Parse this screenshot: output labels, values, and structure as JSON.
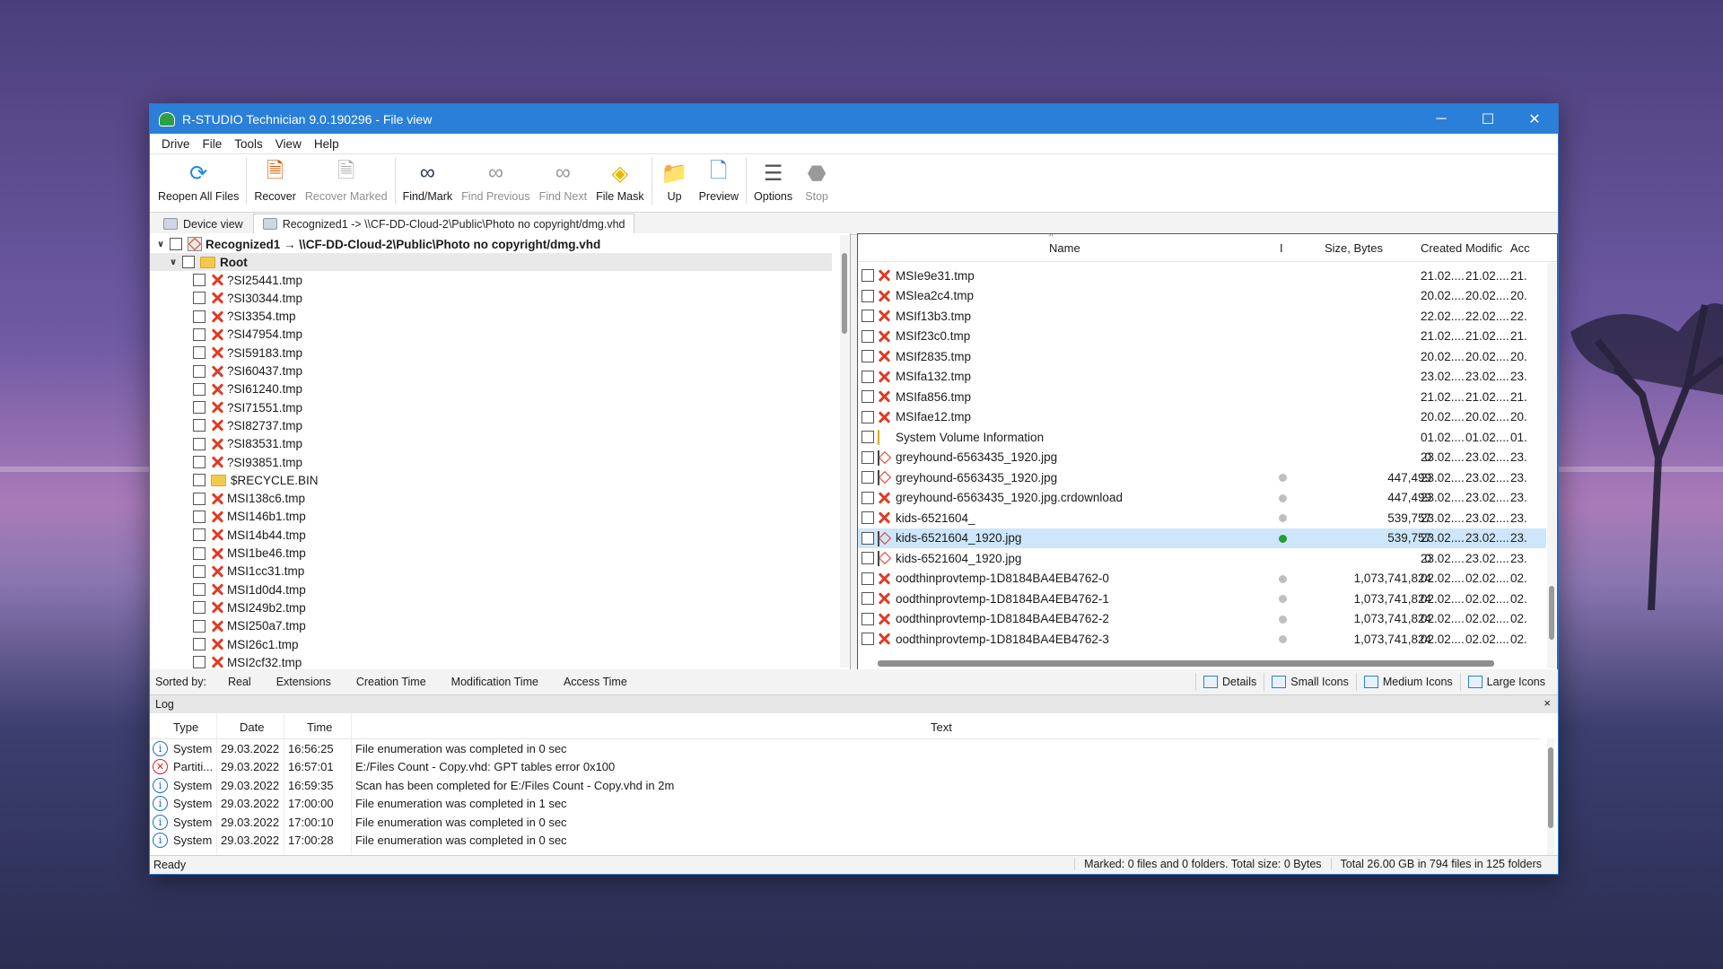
{
  "window": {
    "title": "R-STUDIO Technician 9.0.190296 - File view"
  },
  "menu": [
    "Drive",
    "File",
    "Tools",
    "View",
    "Help"
  ],
  "toolbar": {
    "buttons": [
      {
        "label": "Reopen All Files",
        "icon": "refresh-icon",
        "disabled": false
      },
      {
        "label": "Recover",
        "icon": "recover-icon",
        "disabled": false
      },
      {
        "label": "Recover Marked",
        "icon": "recover-marked-icon",
        "disabled": true
      },
      {
        "label": "Find/Mark",
        "icon": "binoculars-icon",
        "disabled": false
      },
      {
        "label": "Find Previous",
        "icon": "binoculars-prev-icon",
        "disabled": true
      },
      {
        "label": "Find Next",
        "icon": "binoculars-next-icon",
        "disabled": true
      },
      {
        "label": "File Mask",
        "icon": "file-mask-icon",
        "disabled": false
      },
      {
        "label": "Up",
        "icon": "folder-up-icon",
        "disabled": false
      },
      {
        "label": "Preview",
        "icon": "preview-icon",
        "disabled": false
      },
      {
        "label": "Options",
        "icon": "options-icon",
        "disabled": false
      },
      {
        "label": "Stop",
        "icon": "stop-icon",
        "disabled": true
      }
    ]
  },
  "tabs": [
    {
      "label": "Device view"
    },
    {
      "label": "Recognized1 -> \\\\CF-DD-Cloud-2\\Public\\Photo no copyright/dmg.vhd"
    }
  ],
  "tree": {
    "top": "Recognized1 → \\\\CF-DD-Cloud-2\\Public\\Photo no copyright/dmg.vhd",
    "root": "Root",
    "items": [
      {
        "name": "?SI25441.tmp",
        "type": "deleted"
      },
      {
        "name": "?SI30344.tmp",
        "type": "deleted"
      },
      {
        "name": "?SI3354.tmp",
        "type": "deleted"
      },
      {
        "name": "?SI47954.tmp",
        "type": "deleted"
      },
      {
        "name": "?SI59183.tmp",
        "type": "deleted"
      },
      {
        "name": "?SI60437.tmp",
        "type": "deleted"
      },
      {
        "name": "?SI61240.tmp",
        "type": "deleted"
      },
      {
        "name": "?SI71551.tmp",
        "type": "deleted"
      },
      {
        "name": "?SI82737.tmp",
        "type": "deleted"
      },
      {
        "name": "?SI83531.tmp",
        "type": "deleted"
      },
      {
        "name": "?SI93851.tmp",
        "type": "deleted"
      },
      {
        "name": "$RECYCLE.BIN",
        "type": "folder"
      },
      {
        "name": "MSI138c6.tmp",
        "type": "deleted"
      },
      {
        "name": "MSI146b1.tmp",
        "type": "deleted"
      },
      {
        "name": "MSI14b44.tmp",
        "type": "deleted"
      },
      {
        "name": "MSI1be46.tmp",
        "type": "deleted"
      },
      {
        "name": "MSI1cc31.tmp",
        "type": "deleted"
      },
      {
        "name": "MSI1d0d4.tmp",
        "type": "deleted"
      },
      {
        "name": "MSI249b2.tmp",
        "type": "deleted"
      },
      {
        "name": "MSI250a7.tmp",
        "type": "deleted"
      },
      {
        "name": "MSI26c1.tmp",
        "type": "deleted"
      },
      {
        "name": "MSI2cf32.tmp",
        "type": "deleted"
      }
    ]
  },
  "filelist": {
    "columns": {
      "name": "Name",
      "i": "I",
      "size": "Size, Bytes",
      "created": "Created",
      "modified": "Modific",
      "accessed": "Acc"
    },
    "rows": [
      {
        "name": "MSIe9e31.tmp",
        "type": "deleted",
        "dot": "",
        "size": "",
        "created": "21.02....",
        "modified": "21.02....",
        "accessed": "21."
      },
      {
        "name": "MSIea2c4.tmp",
        "type": "deleted",
        "dot": "",
        "size": "",
        "created": "20.02....",
        "modified": "20.02....",
        "accessed": "20."
      },
      {
        "name": "MSIf13b3.tmp",
        "type": "deleted",
        "dot": "",
        "size": "",
        "created": "22.02....",
        "modified": "22.02....",
        "accessed": "22."
      },
      {
        "name": "MSIf23c0.tmp",
        "type": "deleted",
        "dot": "",
        "size": "",
        "created": "21.02....",
        "modified": "21.02....",
        "accessed": "21."
      },
      {
        "name": "MSIf2835.tmp",
        "type": "deleted",
        "dot": "",
        "size": "",
        "created": "20.02....",
        "modified": "20.02....",
        "accessed": "20."
      },
      {
        "name": "MSIfa132.tmp",
        "type": "deleted",
        "dot": "",
        "size": "",
        "created": "23.02....",
        "modified": "23.02....",
        "accessed": "23."
      },
      {
        "name": "MSIfa856.tmp",
        "type": "deleted",
        "dot": "",
        "size": "",
        "created": "21.02....",
        "modified": "21.02....",
        "accessed": "21."
      },
      {
        "name": "MSIfae12.tmp",
        "type": "deleted",
        "dot": "",
        "size": "",
        "created": "20.02....",
        "modified": "20.02....",
        "accessed": "20."
      },
      {
        "name": "System Volume Information",
        "type": "folder",
        "dot": "",
        "size": "",
        "created": "01.02....",
        "modified": "01.02....",
        "accessed": "01."
      },
      {
        "name": "greyhound-6563435_1920.jpg",
        "type": "image-deleted",
        "dot": "",
        "size": "0",
        "created": "23.02....",
        "modified": "23.02....",
        "accessed": "23."
      },
      {
        "name": "greyhound-6563435_1920.jpg",
        "type": "image-deleted",
        "dot": "grey",
        "size": "447,499",
        "created": "23.02....",
        "modified": "23.02....",
        "accessed": "23."
      },
      {
        "name": "greyhound-6563435_1920.jpg.crdownload",
        "type": "deleted",
        "dot": "grey",
        "size": "447,499",
        "created": "23.02....",
        "modified": "23.02....",
        "accessed": "23."
      },
      {
        "name": "kids-6521604_",
        "type": "deleted",
        "dot": "grey",
        "size": "539,757",
        "created": "23.02....",
        "modified": "23.02....",
        "accessed": "23."
      },
      {
        "name": "kids-6521604_1920.jpg",
        "type": "image",
        "dot": "green",
        "size": "539,757",
        "created": "23.02....",
        "modified": "23.02....",
        "accessed": "23.",
        "selected": true
      },
      {
        "name": "kids-6521604_1920.jpg",
        "type": "image-deleted",
        "dot": "",
        "size": "0",
        "created": "23.02....",
        "modified": "23.02....",
        "accessed": "23."
      },
      {
        "name": "oodthinprovtemp-1D8184BA4EB4762-0",
        "type": "deleted",
        "dot": "grey",
        "size": "1,073,741,824",
        "created": "02.02....",
        "modified": "02.02....",
        "accessed": "02."
      },
      {
        "name": "oodthinprovtemp-1D8184BA4EB4762-1",
        "type": "deleted",
        "dot": "grey",
        "size": "1,073,741,824",
        "created": "02.02....",
        "modified": "02.02....",
        "accessed": "02."
      },
      {
        "name": "oodthinprovtemp-1D8184BA4EB4762-2",
        "type": "deleted",
        "dot": "grey",
        "size": "1,073,741,824",
        "created": "02.02....",
        "modified": "02.02....",
        "accessed": "02."
      },
      {
        "name": "oodthinprovtemp-1D8184BA4EB4762-3",
        "type": "deleted",
        "dot": "grey",
        "size": "1,073,741,824",
        "created": "02.02....",
        "modified": "02.02....",
        "accessed": "02."
      }
    ]
  },
  "sortbar": {
    "label": "Sorted by:",
    "options": [
      "Real",
      "Extensions",
      "Creation Time",
      "Modification Time",
      "Access Time"
    ],
    "views": [
      "Details",
      "Small Icons",
      "Medium Icons",
      "Large Icons"
    ]
  },
  "log": {
    "title": "Log",
    "close": "×",
    "columns": {
      "type": "Type",
      "date": "Date",
      "time": "Time",
      "text": "Text"
    },
    "rows": [
      {
        "level": "info",
        "type": "System",
        "date": "29.03.2022",
        "time": "16:56:25",
        "text": "File enumeration was completed in 0 sec"
      },
      {
        "level": "error",
        "type": "Partiti...",
        "date": "29.03.2022",
        "time": "16:57:01",
        "text": "E:/Files Count - Copy.vhd: GPT tables error 0x100"
      },
      {
        "level": "info",
        "type": "System",
        "date": "29.03.2022",
        "time": "16:59:35",
        "text": "Scan has been completed for E:/Files Count - Copy.vhd in 2m"
      },
      {
        "level": "info",
        "type": "System",
        "date": "29.03.2022",
        "time": "17:00:00",
        "text": "File enumeration was completed in 1 sec"
      },
      {
        "level": "info",
        "type": "System",
        "date": "29.03.2022",
        "time": "17:00:10",
        "text": "File enumeration was completed in 0 sec"
      },
      {
        "level": "info",
        "type": "System",
        "date": "29.03.2022",
        "time": "17:00:28",
        "text": "File enumeration was completed in 0 sec"
      }
    ]
  },
  "status": {
    "ready": "Ready",
    "marked": "Marked: 0 files and 0 folders. Total size: 0 Bytes",
    "total": "Total 26.00 GB in 794 files in 125 folders"
  },
  "colors": {
    "titlebar": "#2a7fd8",
    "selected_row": "#cde6fb",
    "deleted_mark": "#e03b24",
    "ok_dot": "#1fa12b"
  }
}
